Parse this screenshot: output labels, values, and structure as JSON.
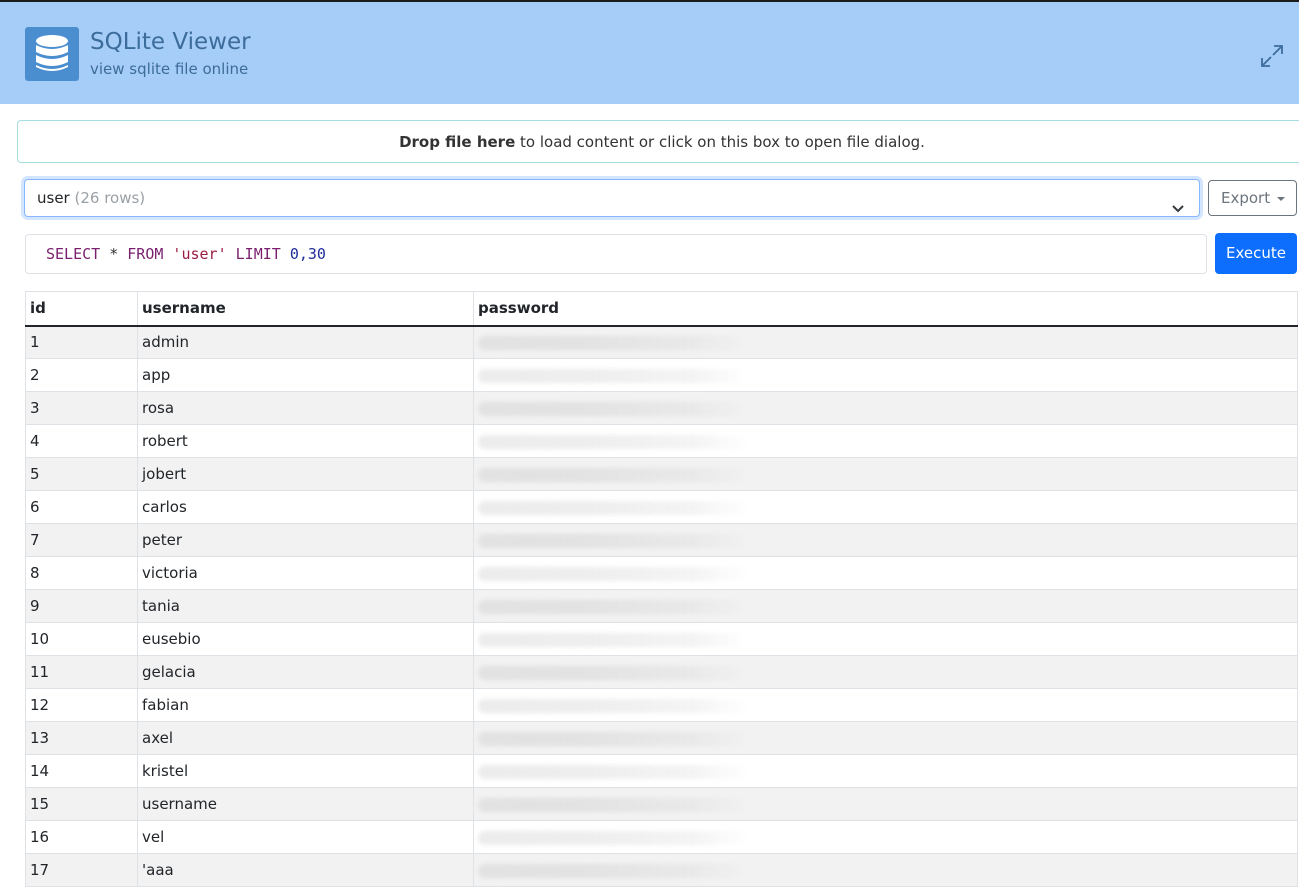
{
  "app": {
    "title": "SQLite Viewer",
    "subtitle": "view sqlite file online",
    "logo_icon": "database-icon",
    "fullscreen_icon": "expand-icon"
  },
  "dropzone": {
    "bold": "Drop file here",
    "rest": " to load content or click on this box to open file dialog."
  },
  "table_select": {
    "table": "user",
    "rows": "(26 rows)"
  },
  "export": {
    "label": "Export"
  },
  "query": {
    "select": "SELECT",
    "star": " * ",
    "from": "FROM",
    "table": " 'user' ",
    "limit": "LIMIT",
    "range": " 0,30"
  },
  "execute": {
    "label": "Execute"
  },
  "results": {
    "columns": [
      "id",
      "username",
      "password"
    ],
    "rows": [
      {
        "id": "1",
        "username": "admin"
      },
      {
        "id": "2",
        "username": "app"
      },
      {
        "id": "3",
        "username": "rosa"
      },
      {
        "id": "4",
        "username": "robert"
      },
      {
        "id": "5",
        "username": "jobert"
      },
      {
        "id": "6",
        "username": "carlos"
      },
      {
        "id": "7",
        "username": "peter"
      },
      {
        "id": "8",
        "username": "victoria"
      },
      {
        "id": "9",
        "username": "tania"
      },
      {
        "id": "10",
        "username": "eusebio"
      },
      {
        "id": "11",
        "username": "gelacia"
      },
      {
        "id": "12",
        "username": "fabian"
      },
      {
        "id": "13",
        "username": "axel"
      },
      {
        "id": "14",
        "username": "kristel"
      },
      {
        "id": "15",
        "username": "username"
      },
      {
        "id": "16",
        "username": "vel"
      },
      {
        "id": "17",
        "username": "'aaa"
      }
    ]
  },
  "colors": {
    "header_bg": "#a6cdf7",
    "logo_bg": "#4a8ed0",
    "primary": "#0d6efd",
    "title_text": "#3c6c9b"
  }
}
